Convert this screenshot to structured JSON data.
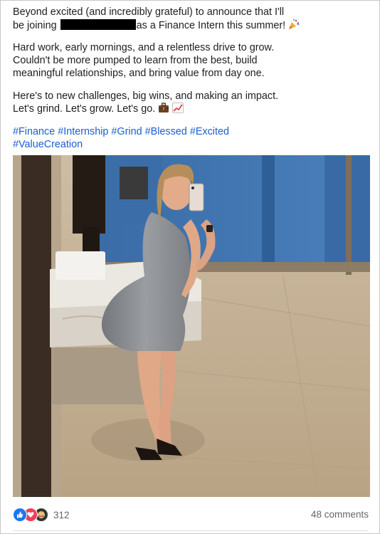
{
  "post": {
    "paragraph1": {
      "line1": "Beyond excited (and incredibly grateful) to announce that I'll",
      "line2_before": "be joining",
      "line2_after": "as a Finance Intern this summer!"
    },
    "paragraph2": {
      "line1": "Hard work, early mornings, and a relentless drive to grow.",
      "line2": "Couldn't be more pumped to learn from the best, build",
      "line3": "meaningful relationships, and bring value from day one."
    },
    "paragraph3": {
      "line1": "Here's to new challenges, big wins, and making an impact.",
      "line2": "Let's grind. Let's grow. Let's go."
    },
    "hashtags": [
      "#Finance",
      "#Internship",
      "#Grind",
      "#Blessed",
      "#Excited",
      "#ValueCreation"
    ],
    "emojis": {
      "party": "party-popper-icon",
      "briefcase": "briefcase-icon",
      "chart": "chart-increasing-icon"
    }
  },
  "photo": {
    "description_icon": "mirror-selfie-photo",
    "colors": {
      "wall": "#3f74b0",
      "floor": "#c9b79c",
      "counter": "#e9e6e1",
      "dress": "#8a8d90",
      "skin": "#e3ad8a"
    }
  },
  "footer": {
    "reaction_icons": [
      "like-icon",
      "love-icon",
      "care-icon"
    ],
    "reaction_count": "312",
    "comments": "48 comments"
  }
}
